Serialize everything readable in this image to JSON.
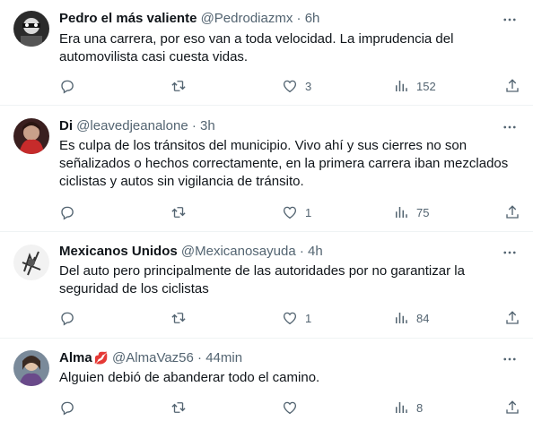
{
  "tweets": [
    {
      "name": "Pedro el más valiente",
      "handle": "@Pedrodiazmx",
      "time": "6h",
      "emoji": "",
      "text_lines": [
        "Era una carrera, por eso van a toda velocidad. La imprudencia del",
        "automovilista casi cuesta vidas."
      ],
      "replies": "",
      "retweets": "",
      "likes": "3",
      "views": "152"
    },
    {
      "name": "Di",
      "handle": "@leavedjeanalone",
      "time": "3h",
      "emoji": "",
      "text_lines": [
        "Es culpa de los tránsitos del municipio. Vivo ahí y sus cierres no son",
        "señalizados o hechos correctamente, en la primera carrera iban mezclados",
        "ciclistas y autos sin vigilancia de tránsito."
      ],
      "replies": "",
      "retweets": "",
      "likes": "1",
      "views": "75"
    },
    {
      "name": "Mexicanos Unidos",
      "handle": "@Mexicanosayuda",
      "time": "4h",
      "emoji": "",
      "text_lines": [
        "Del auto pero principalmente de las autoridades por no garantizar la",
        "seguridad de los ciclistas"
      ],
      "replies": "",
      "retweets": "",
      "likes": "1",
      "views": "84"
    },
    {
      "name": "Alma",
      "handle": "@AlmaVaz56",
      "time": "44min",
      "emoji": "💋",
      "text_lines": [
        "Alguien debió de abanderar todo el camino."
      ],
      "replies": "",
      "retweets": "",
      "likes": "",
      "views": "8"
    }
  ],
  "separator": "·",
  "icons": {
    "reply": "reply-icon",
    "retweet": "retweet-icon",
    "like": "heart-icon",
    "views": "views-icon",
    "share": "share-icon",
    "more": "more-icon"
  },
  "colors": {
    "text": "#0f1419",
    "secondary": "#536471",
    "border": "#eff3f4"
  }
}
